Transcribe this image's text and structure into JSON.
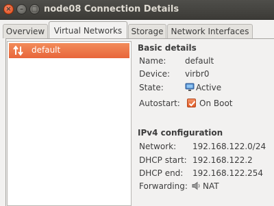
{
  "window": {
    "title": "node08 Connection Details",
    "close_glyph": "×",
    "minimize_glyph": "–",
    "maximize_glyph": "□"
  },
  "tabs": [
    {
      "label": "Overview",
      "active": false
    },
    {
      "label": "Virtual Networks",
      "active": true
    },
    {
      "label": "Storage",
      "active": false
    },
    {
      "label": "Network Interfaces",
      "active": false
    }
  ],
  "networks": [
    {
      "name": "default",
      "icon": "network-arrows-icon",
      "selected": true
    }
  ],
  "basic": {
    "heading": "Basic details",
    "name_label": "Name:",
    "name_value": "default",
    "device_label": "Device:",
    "device_value": "virbr0",
    "state_label": "State:",
    "state_value": "Active",
    "state_icon": "monitor-active-icon",
    "autostart_label": "Autostart:",
    "autostart_value": "On Boot",
    "autostart_checked": true
  },
  "ipv4": {
    "heading": "IPv4 configuration",
    "network_label": "Network:",
    "network_value": "192.168.122.0/24",
    "dhcp_start_label": "DHCP start:",
    "dhcp_start_value": "192.168.122.2",
    "dhcp_end_label": "DHCP end:",
    "dhcp_end_value": "192.168.122.254",
    "forwarding_label": "Forwarding:",
    "forwarding_value": "NAT",
    "forwarding_icon": "forwarding-speaker-icon"
  },
  "colors": {
    "selection": "#e8653a",
    "titlebar": "#3c3b37",
    "close_button": "#df4a16"
  }
}
